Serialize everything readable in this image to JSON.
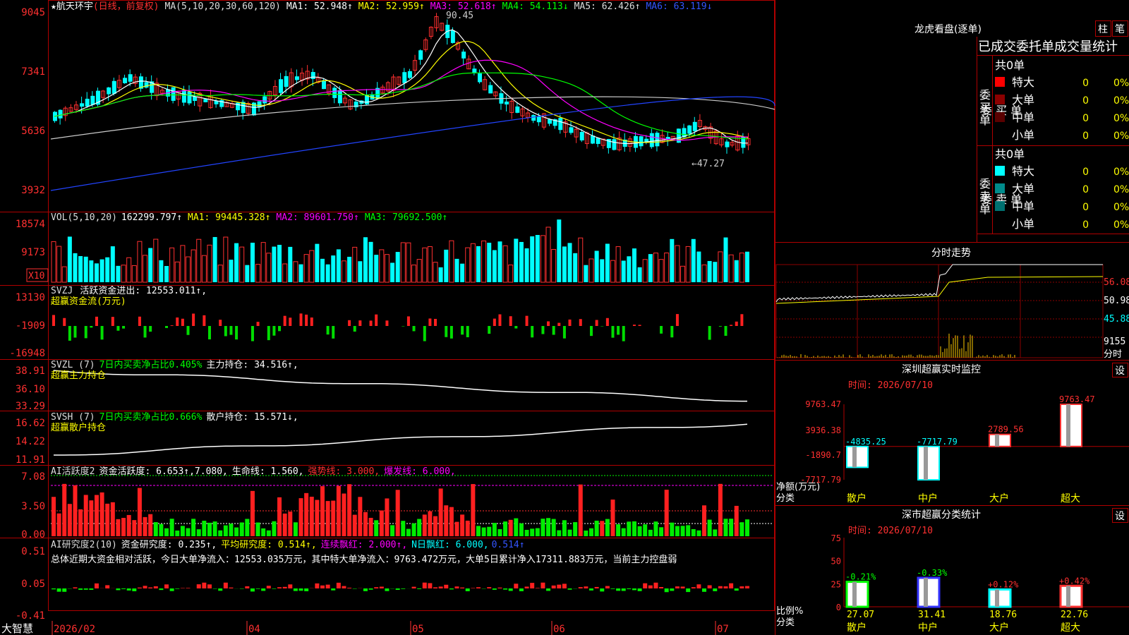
{
  "stock": {
    "star": "★",
    "name": "航天环宇",
    "period": "(日线，前复权)"
  },
  "main": {
    "ma_label": "MA(5,10,20,30,60,120)",
    "ma": [
      {
        "text": "MA1: 52.948↑",
        "color": "#ffffff"
      },
      {
        "text": "MA2: 52.959↑",
        "color": "#ffff00"
      },
      {
        "text": "MA3: 52.618↑",
        "color": "#ff00ff"
      },
      {
        "text": "MA4: 54.113↓",
        "color": "#00ff00"
      },
      {
        "text": "MA5: 62.426↑",
        "color": "#dddddd"
      },
      {
        "text": "MA6: 63.119↓",
        "color": "#3355ff"
      }
    ],
    "yticks": [
      "9045",
      "7341",
      "5636",
      "3932"
    ],
    "high": "90.45",
    "low": "←47.27"
  },
  "vol": {
    "label": "VOL(5,10,20)",
    "v": "162299.797↑",
    "ma1": "MA1: 99445.328↑",
    "ma2": "MA2: 89601.750↑",
    "ma3": "MA3: 79692.500↑",
    "yticks": [
      "18574",
      "9173"
    ],
    "unit": "X10"
  },
  "svzj": {
    "label": "SVZJ",
    "text": "活跃资金进出: 12553.011↑,",
    "sub": "超赢资金流(万元)",
    "yticks": [
      "13130",
      "-1909",
      "-16948"
    ]
  },
  "svzl": {
    "label": "SVZL (7)",
    "green": "7日内买卖净占比0.405%",
    "white": "主力持仓: 34.516↑,",
    "sub": "超赢主力持仓",
    "yticks": [
      "38.91",
      "36.10",
      "33.29"
    ]
  },
  "svsh": {
    "label": "SVSH (7)",
    "green": "7日内买卖净占比0.666%",
    "white": "散户持仓: 15.571↓,",
    "sub": "超赢散户持仓",
    "yticks": [
      "16.62",
      "14.22",
      "11.91"
    ]
  },
  "ai1": {
    "label": "AI活跃度2",
    "a": "资金活跃度: 6.653↑,7.080,",
    "b": "生命线: 1.560,",
    "c": "强势线: 3.000,",
    "d": "爆发线: 6.000,",
    "yticks": [
      "7.08",
      "3.50",
      "0.00"
    ]
  },
  "ai2": {
    "label": "AI研究度2(10)",
    "a": "资金研究度: 0.235↑,",
    "b": "平均研究度: 0.514↑,",
    "c": "连续飘红: 2.000↑,",
    "d": "N日飘红: 6.000,",
    "e": "0.514↑",
    "summary": "总体近期大资金相对活跃，今日大单净流入：12553.035万元，其中特大单净流入：9763.472万元，大单5日累计净入17311.883万元，当前主力控盘弱",
    "yticks": [
      "0.51",
      "0.05",
      "-0.41"
    ]
  },
  "xaxis": {
    "brand": "大智慧",
    "labels": [
      "2026/02",
      "04",
      "05",
      "06",
      "07"
    ]
  },
  "lhb": {
    "title": "龙虎看盘(逐单)",
    "btn1": "柱",
    "btn2": "笔",
    "header": "已成交委托单成交量统计",
    "buy": {
      "title": "委买单",
      "total": "共0单",
      "rows": [
        {
          "name": "特大",
          "color": "#ff0000",
          "n": "0",
          "p": "0%"
        },
        {
          "name": "大单",
          "color": "#8b0000",
          "n": "0",
          "p": "0%"
        },
        {
          "name": "中单",
          "color": "#5a0000",
          "n": "0",
          "p": "0%"
        },
        {
          "name": "小单",
          "color": "",
          "n": "0",
          "p": "0%"
        }
      ]
    },
    "sell": {
      "title": "委卖单",
      "total": "共0单",
      "rows": [
        {
          "name": "特大",
          "color": "#00ffff",
          "n": "0",
          "p": "0%"
        },
        {
          "name": "大单",
          "color": "#008b8b",
          "n": "0",
          "p": "0%"
        },
        {
          "name": "中单",
          "color": "#007070",
          "n": "0",
          "p": "0%"
        },
        {
          "name": "小单",
          "color": "",
          "n": "0",
          "p": "0%"
        }
      ]
    }
  },
  "fs": {
    "title": "分时走势",
    "yticks": [
      "56.08",
      "50.98",
      "45.88"
    ],
    "vol": "9155",
    "unit": "分时"
  },
  "sz1": {
    "title": "深圳超赢实时监控",
    "btn": "设",
    "time": "时间: 2026/07/10",
    "unit": "净额(万元)",
    "cat": "分类",
    "yticks": [
      "9763.47",
      "3936.38",
      "-1890.7",
      "-7717.79"
    ],
    "chart_data": {
      "type": "bar",
      "categories": [
        "散户",
        "中户",
        "大户",
        "超大"
      ],
      "values": [
        -4835.25,
        -7717.79,
        2789.56,
        9763.47
      ],
      "labels": [
        "-4835.25",
        "-7717.79",
        "2789.56",
        "9763.47"
      ],
      "ylim": [
        -7717.79,
        9763.47
      ]
    }
  },
  "sz2": {
    "title": "深市超赢分类统计",
    "btn": "设",
    "time": "时间: 2026/07/10",
    "unit": "比例%",
    "cat": "分类",
    "yticks": [
      "75",
      "50",
      "25",
      "0"
    ],
    "chart_data": {
      "type": "bar",
      "categories": [
        "散户",
        "中户",
        "大户",
        "超大"
      ],
      "values": [
        27.07,
        31.41,
        18.76,
        22.76
      ],
      "changes": [
        "-0.21%",
        "-0.33%",
        "+0.12%",
        "+0.42%"
      ],
      "ylim": [
        0,
        75
      ]
    }
  }
}
